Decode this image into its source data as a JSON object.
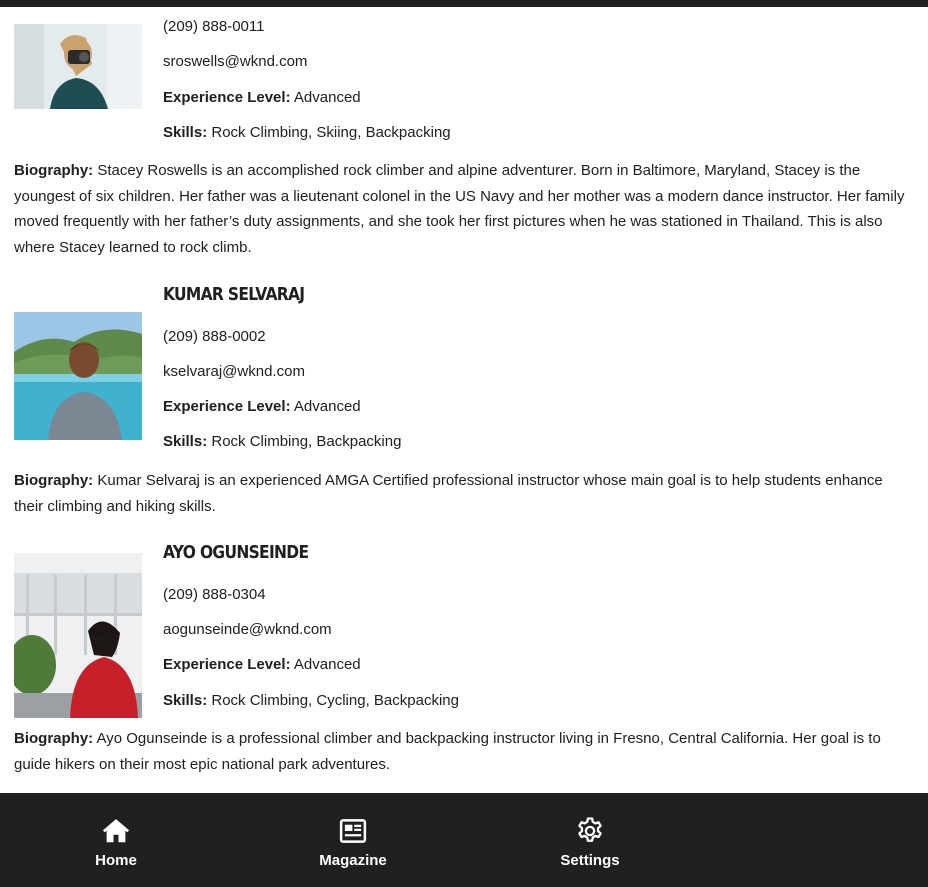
{
  "people": [
    {
      "name": "",
      "phone": "(209) 888-0011",
      "email": "sroswells@wknd.com",
      "experience_label": "Experience Level:",
      "experience": "Advanced",
      "skills_label": "Skills:",
      "skills": "Rock Climbing, Skiing, Backpacking",
      "bio_label": "Biography:",
      "bio": "Stacey Roswells is an accomplished rock climber and alpine adventurer. Born in Baltimore, Maryland, Stacey is the youngest of six children. Her father was a lieutenant colonel in the US Navy and her mother was a modern dance instructor. Her family moved frequently with her father’s duty assignments, and she took her first pictures when he was stationed in Thailand. This is also where Stacey learned to rock climb."
    },
    {
      "name": "Kumar Selvaraj",
      "phone": "(209) 888-0002",
      "email": "kselvaraj@wknd.com",
      "experience_label": "Experience Level:",
      "experience": "Advanced",
      "skills_label": "Skills:",
      "skills": "Rock Climbing, Backpacking",
      "bio_label": "Biography:",
      "bio": "Kumar Selvaraj is an experienced AMGA Certified professional instructor whose main goal is to help students enhance their climbing and hiking skills."
    },
    {
      "name": "Ayo Ogunseinde",
      "phone": "(209) 888-0304",
      "email": "aogunseinde@wknd.com",
      "experience_label": "Experience Level:",
      "experience": "Advanced",
      "skills_label": "Skills:",
      "skills": "Rock Climbing, Cycling, Backpacking",
      "bio_label": "Biography:",
      "bio": "Ayo Ogunseinde is a professional climber and backpacking instructor living in Fresno, Central California. Her goal is to guide hikers on their most epic national park adventures."
    }
  ],
  "nav": {
    "items": [
      {
        "label": "Home",
        "icon": "home-icon"
      },
      {
        "label": "Magazine",
        "icon": "newspaper-icon"
      },
      {
        "label": "Settings",
        "icon": "gear-icon"
      }
    ]
  },
  "colors": {
    "bar": "#202020",
    "text": "#202020",
    "background": "#ffffff"
  }
}
